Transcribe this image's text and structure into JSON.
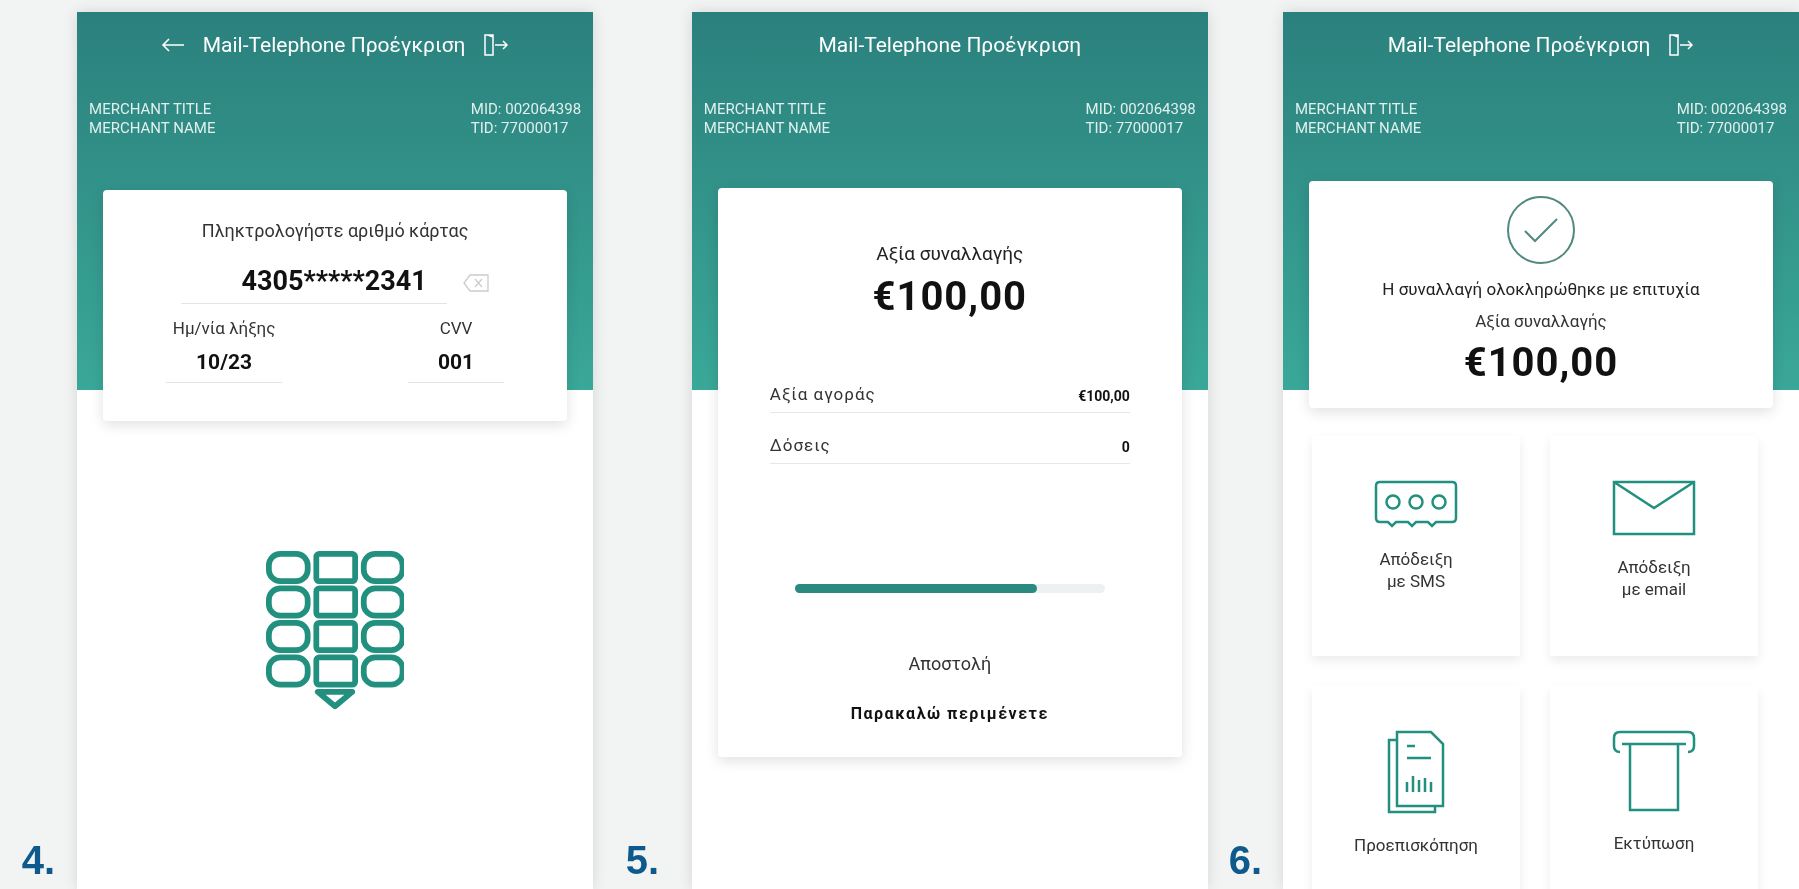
{
  "screens": [
    {
      "step": "4.",
      "kind": "card_entry",
      "title": "Mail-Telephone Προέγκριση",
      "back_button": true,
      "logout_button": true,
      "merchant_title": "MERCHANT TITLE",
      "merchant_name": "MERCHANT NAME",
      "mid": "MID: 002064398",
      "tid": "TID: 77000017",
      "prompt": "Πληκτρολογήστε αριθμό κάρτας",
      "card_number": "4305*****2341",
      "expiry_label": "Ημ/νία λήξης",
      "expiry": "10/23",
      "cvv_label": "CVV",
      "cvv": "001"
    },
    {
      "step": "5.",
      "kind": "processing",
      "title": "Mail-Telephone Προέγκριση",
      "back_button": false,
      "logout_button": false,
      "merchant_title": "MERCHANT TITLE",
      "merchant_name": "MERCHANT NAME",
      "mid": "MID: 002064398",
      "tid": "TID: 77000017",
      "amount_label": "Αξία συναλλαγής",
      "amount": "€100,00",
      "rows": [
        {
          "label": "Αξία αγοράς",
          "value": "€100,00"
        },
        {
          "label": "Δόσεις",
          "value": "0"
        }
      ],
      "progress": {
        "level": 0.78
      },
      "status": "Αποστολή",
      "message": "Παρακαλώ περιμένετε"
    },
    {
      "step": "6.",
      "kind": "success",
      "title": "Mail-Telephone Προέγκριση",
      "back_button": false,
      "logout_button": true,
      "merchant_title": "MERCHANT TITLE",
      "merchant_name": "MERCHANT NAME",
      "mid": "MID: 002064398",
      "tid": "TID: 77000017",
      "result": "Η συναλλαγή ολοκληρώθηκε με επιτυχία",
      "amount_label": "Αξία συναλλαγής",
      "amount": "€100,00",
      "actions": [
        {
          "kind": "sms",
          "label": "Απόδειξη\nμε SMS"
        },
        {
          "kind": "email",
          "label": "Απόδειξη\nμε email"
        },
        {
          "kind": "preview",
          "label": "Προεπισκόπηση"
        },
        {
          "kind": "print",
          "label": "Εκτύπωση"
        }
      ]
    }
  ]
}
